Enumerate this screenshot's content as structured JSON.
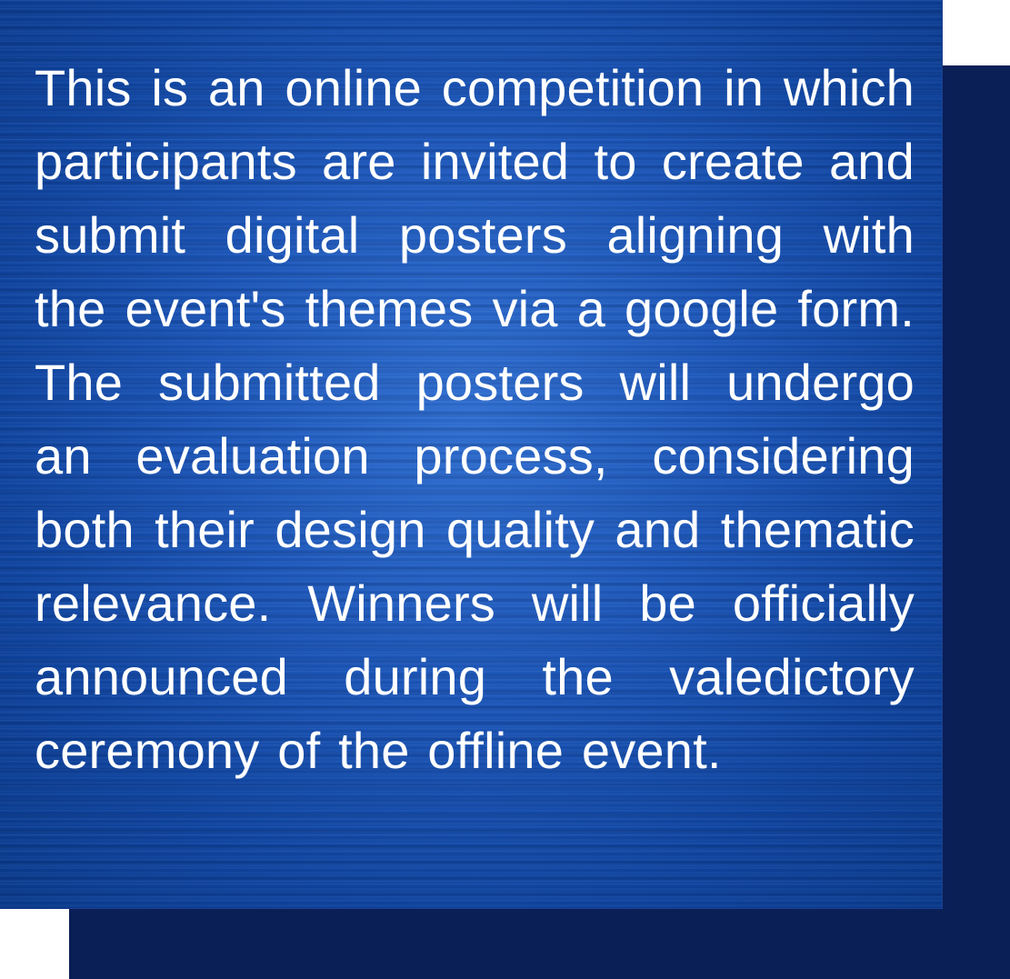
{
  "description": {
    "text": "This is an online competition in which participants are invited to create and submit digital posters aligning with the event's themes via a google form. The submitted posters will undergo an evaluation process, considering both their design quality and thematic relevance. Winners will be officially announced during the valedictory ceremony of the offline event."
  },
  "colors": {
    "card_background": "#1c56b8",
    "shadow_panel": "#0a1f56",
    "text": "#ffffff",
    "page_background": "#ffffff"
  }
}
